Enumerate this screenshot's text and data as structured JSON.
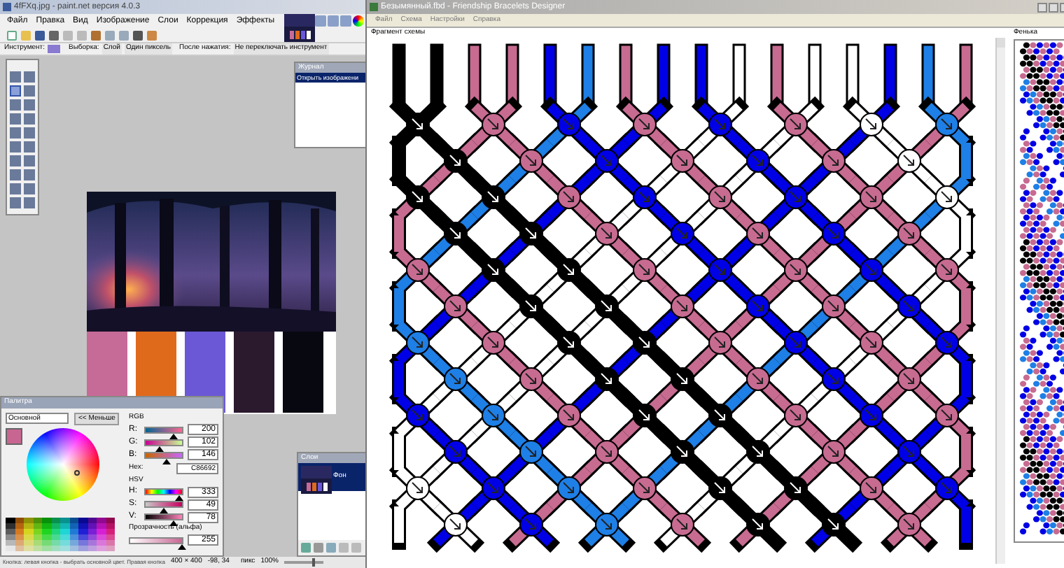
{
  "editor": {
    "title": "4fFXq.jpg - paint.net версия 4.0.3",
    "menu": [
      "Файл",
      "Правка",
      "Вид",
      "Изображение",
      "Слои",
      "Коррекция",
      "Эффекты"
    ],
    "options": {
      "tool_label": "Инструмент:",
      "selection_label": "Выборка:",
      "layer": "Слой",
      "sampling": "Один пиксель",
      "after_label": "После нажатия:",
      "after_value": "Не переключать инструмент"
    },
    "history": {
      "title": "Журнал",
      "items": [
        {
          "label": "Открыть изображени",
          "selected": true
        }
      ]
    },
    "swatches": [
      {
        "color": "#c66a98"
      },
      {
        "color": "#df6a1c"
      },
      {
        "color": "#6a58d6"
      },
      {
        "color": "#2b1a2e"
      },
      {
        "color": "#080810"
      }
    ],
    "palette": {
      "title": "Палитра",
      "mode": "Основной",
      "less_button": "<< Меньше",
      "rgb_label": "RGB",
      "hex_label": "Hex:",
      "hex": "C86692",
      "hsv_label": "HSV",
      "alpha_label": "Прозрачность (альфа)",
      "rgb": [
        {
          "label": "R:",
          "value": "200",
          "level": 0.78,
          "kind": "r"
        },
        {
          "label": "G:",
          "value": "102",
          "level": 0.4,
          "kind": "g"
        },
        {
          "label": "B:",
          "value": "146",
          "level": 0.57,
          "kind": "b"
        }
      ],
      "hsv": [
        {
          "label": "H:",
          "value": "333",
          "level": 0.92,
          "kind": "h"
        },
        {
          "label": "S:",
          "value": "49",
          "level": 0.49,
          "kind": "s"
        },
        {
          "label": "V:",
          "value": "78",
          "level": 0.78,
          "kind": "v"
        }
      ],
      "alpha": {
        "value": "255",
        "level": 1
      }
    },
    "layers": {
      "title": "Слои",
      "items": [
        {
          "label": "Фон",
          "selected": true
        }
      ]
    },
    "status": {
      "hint": "Кнопка: левая кнопка - выбрать основной цвет. Правая кнопка",
      "size": "400 × 400",
      "position": "-98, 34",
      "units": "пикс",
      "zoom": "100%",
      "zoom_slider": {
        "level": 0.75
      }
    }
  },
  "designer": {
    "title": "Безымянный.fbd - Friendship Bracelets Designer",
    "menu": [
      "Файл",
      "Схема",
      "Настройки",
      "Справка"
    ],
    "scheme_label": "Фрагмент схемы",
    "preview_label": "Фенька",
    "strands": [
      {
        "color": "#000000"
      },
      {
        "color": "#000000"
      },
      {
        "color": "#c76b91"
      },
      {
        "color": "#c76b91"
      },
      {
        "color": "#0000e6"
      },
      {
        "color": "#1e7fe6"
      },
      {
        "color": "#c76b91"
      },
      {
        "color": "#0000e6"
      },
      {
        "color": "#0000e6"
      },
      {
        "color": "#ffffff"
      },
      {
        "color": "#c76b91"
      },
      {
        "color": "#ffffff"
      },
      {
        "color": "#ffffff"
      },
      {
        "color": "#0000e6"
      },
      {
        "color": "#1e7fe6"
      },
      {
        "color": "#c76b91"
      }
    ]
  }
}
